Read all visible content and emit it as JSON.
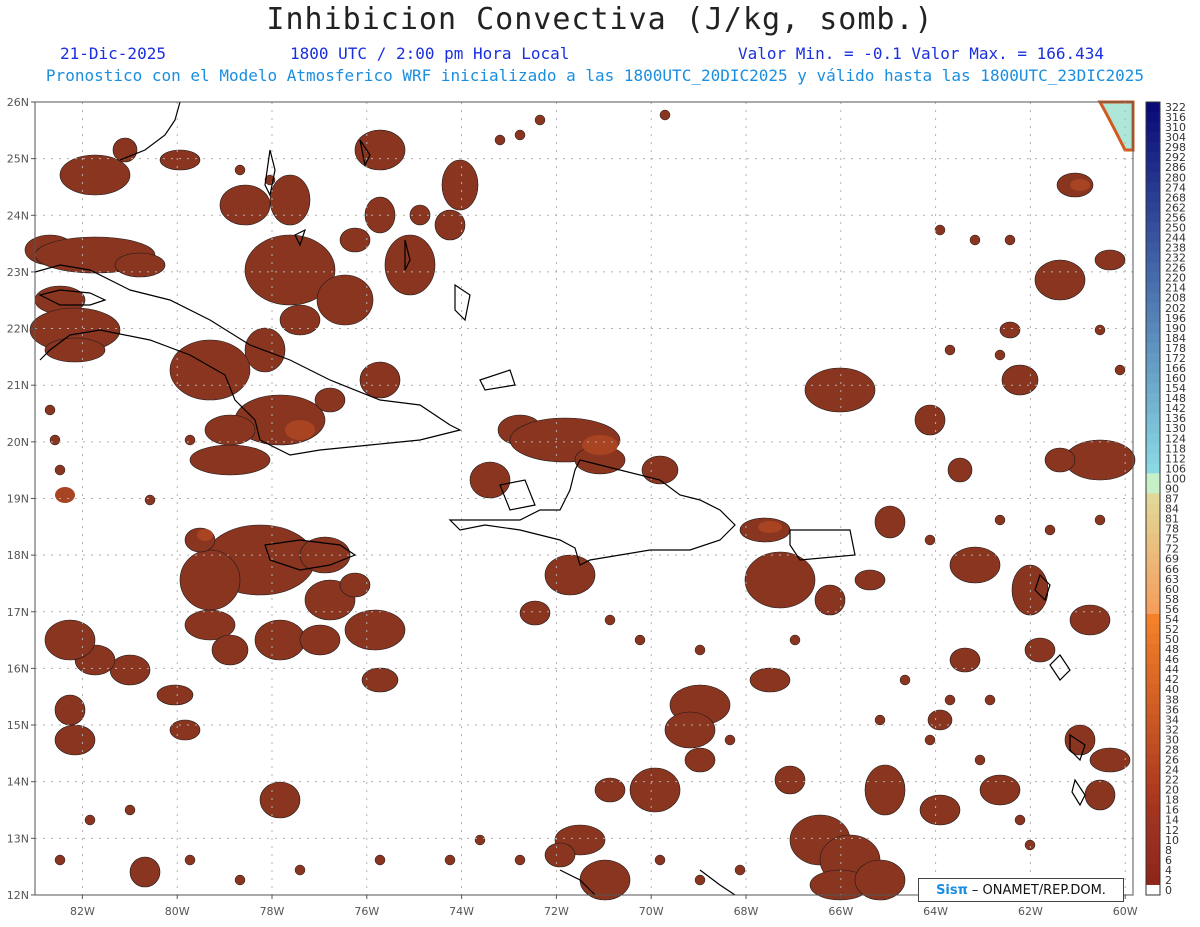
{
  "title": "Inhibicion Convectiva (J/kg, somb.)",
  "date": "21-Dic-2025",
  "time": "1800 UTC / 2:00 pm Hora Local",
  "minmax": "Valor Min. = -0.1  Valor Max. = 166.434",
  "subtitle": "Pronostico con el Modelo Atmosferico WRF inicializado a las 1800UTC_20DIC2025 y válido hasta las  1800UTC_23DIC2025",
  "credit": {
    "sis": "Sisπ",
    "text": "– ONAMET/REP.DOM."
  },
  "colors": {
    "cin_fill": "#8a3520",
    "cin_mid": "#a84422",
    "coast": "#000000",
    "grid": "#b0b0b0",
    "text_blue": "#1a2fe0",
    "text_cyan": "#1a8ee0"
  },
  "lat_labels": [
    "26N",
    "25N",
    "24N",
    "23N",
    "22N",
    "21N",
    "20N",
    "19N",
    "18N",
    "17N",
    "16N",
    "15N",
    "14N",
    "13N",
    "12N"
  ],
  "lon_labels": [
    "82W",
    "80W",
    "78W",
    "76W",
    "74W",
    "72W",
    "70W",
    "68W",
    "66W",
    "64W",
    "62W",
    "60W"
  ],
  "colorbar_labels": [
    "322",
    "316",
    "310",
    "304",
    "298",
    "292",
    "286",
    "280",
    "274",
    "268",
    "262",
    "256",
    "250",
    "244",
    "238",
    "232",
    "226",
    "220",
    "214",
    "208",
    "202",
    "196",
    "190",
    "184",
    "178",
    "172",
    "166",
    "160",
    "154",
    "148",
    "142",
    "136",
    "130",
    "124",
    "118",
    "112",
    "106",
    "100",
    "90",
    "87",
    "84",
    "81",
    "78",
    "75",
    "72",
    "69",
    "66",
    "63",
    "60",
    "58",
    "56",
    "54",
    "52",
    "50",
    "48",
    "46",
    "44",
    "42",
    "40",
    "38",
    "36",
    "34",
    "32",
    "30",
    "28",
    "26",
    "24",
    "22",
    "20",
    "18",
    "16",
    "14",
    "12",
    "10",
    "8",
    "6",
    "4",
    "2",
    "0"
  ],
  "map_layers": [
    "coastlines",
    "gridlines",
    "cin_shading"
  ]
}
